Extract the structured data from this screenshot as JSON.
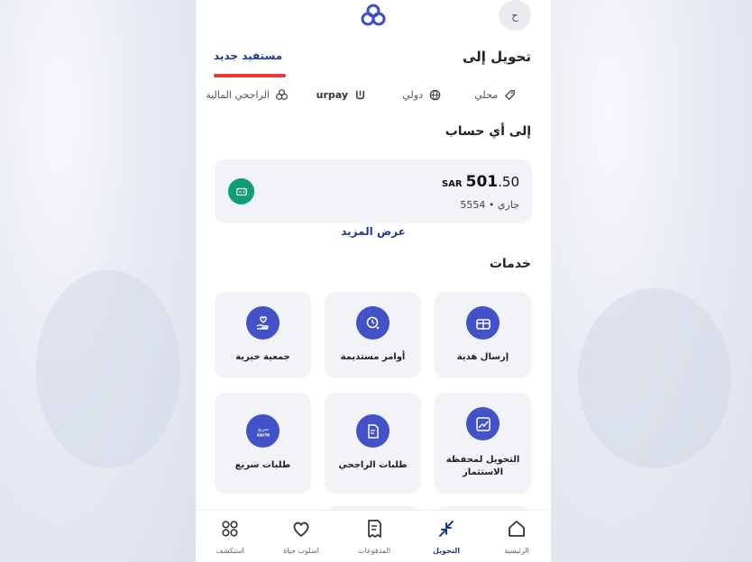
{
  "header": {
    "avatar_initial": "ح"
  },
  "transfer": {
    "title": "تحويل إلى",
    "new_beneficiary": "مستفيد جديد"
  },
  "categories": [
    {
      "label": "محلي",
      "icon": "tag-icon"
    },
    {
      "label": "دولي",
      "icon": "globe-icon"
    },
    {
      "label": "urpay",
      "icon": "urpay-icon"
    },
    {
      "label": "الراجحي المالية",
      "icon": "alrajhi-capital-icon"
    }
  ],
  "accounts": {
    "title": "إلى أي حساب",
    "items": [
      {
        "currency": "SAR",
        "amount_int": "501",
        "amount_dec": ".50",
        "type": "جاري",
        "number": "5554"
      }
    ],
    "show_more": "عرض المزيد"
  },
  "services": {
    "title": "خدمات",
    "items": [
      {
        "label": "إرسال هدية",
        "icon": "gift-icon"
      },
      {
        "label": "أوامر مستديمة",
        "icon": "standing-order-icon"
      },
      {
        "label": "جمعية خيرية",
        "icon": "charity-icon"
      },
      {
        "label": "التحويل لمحفظة الاستثمار",
        "icon": "chart-up-icon"
      },
      {
        "label": "طلبات الراجحي",
        "icon": "document-icon"
      },
      {
        "label": "طلبات سريع",
        "icon": "sarie-icon"
      }
    ]
  },
  "nav": {
    "items": [
      {
        "label": "الرئيسية",
        "icon": "home-icon"
      },
      {
        "label": "التحويل",
        "icon": "transfer-icon"
      },
      {
        "label": "المدفوعات",
        "icon": "payments-icon"
      },
      {
        "label": "اسلوب حياة",
        "icon": "heart-icon"
      },
      {
        "label": "استكشف",
        "icon": "grid-icon"
      }
    ],
    "active": "التحويل"
  },
  "colors": {
    "brand_blue": "#1e3a8a",
    "icon_bg": "#4352c7",
    "account_icon": "#0f9d75",
    "underline_red": "#e53935"
  }
}
